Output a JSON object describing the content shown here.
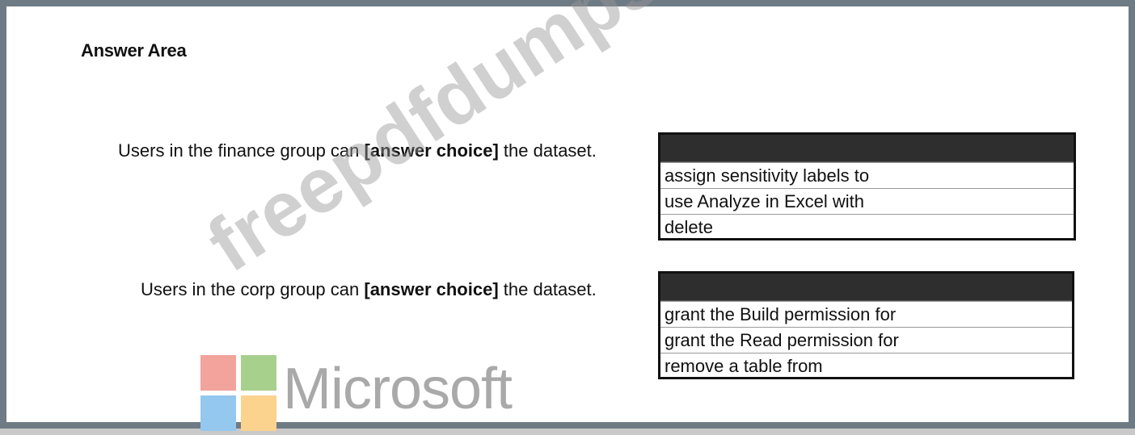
{
  "answer_area": {
    "title": "Answer Area"
  },
  "questions": [
    {
      "prefix": "Users in the finance group can ",
      "placeholder": "[answer choice]",
      "suffix": " the dataset.",
      "options": [
        "assign sensitivity labels to",
        "use Analyze in Excel with",
        "delete"
      ]
    },
    {
      "prefix": "Users in the corp group can ",
      "placeholder": "[answer choice]",
      "suffix": " the dataset.",
      "options": [
        "grant the Build permission for",
        "grant the Read permission for",
        "remove a table from"
      ]
    }
  ],
  "logo": {
    "wordmark": "Microsoft",
    "tile_colors": [
      "#f2a39b",
      "#a8d08d",
      "#95c8ee",
      "#fbd28e"
    ]
  },
  "watermark": {
    "text": "freepdfdumps.com"
  }
}
